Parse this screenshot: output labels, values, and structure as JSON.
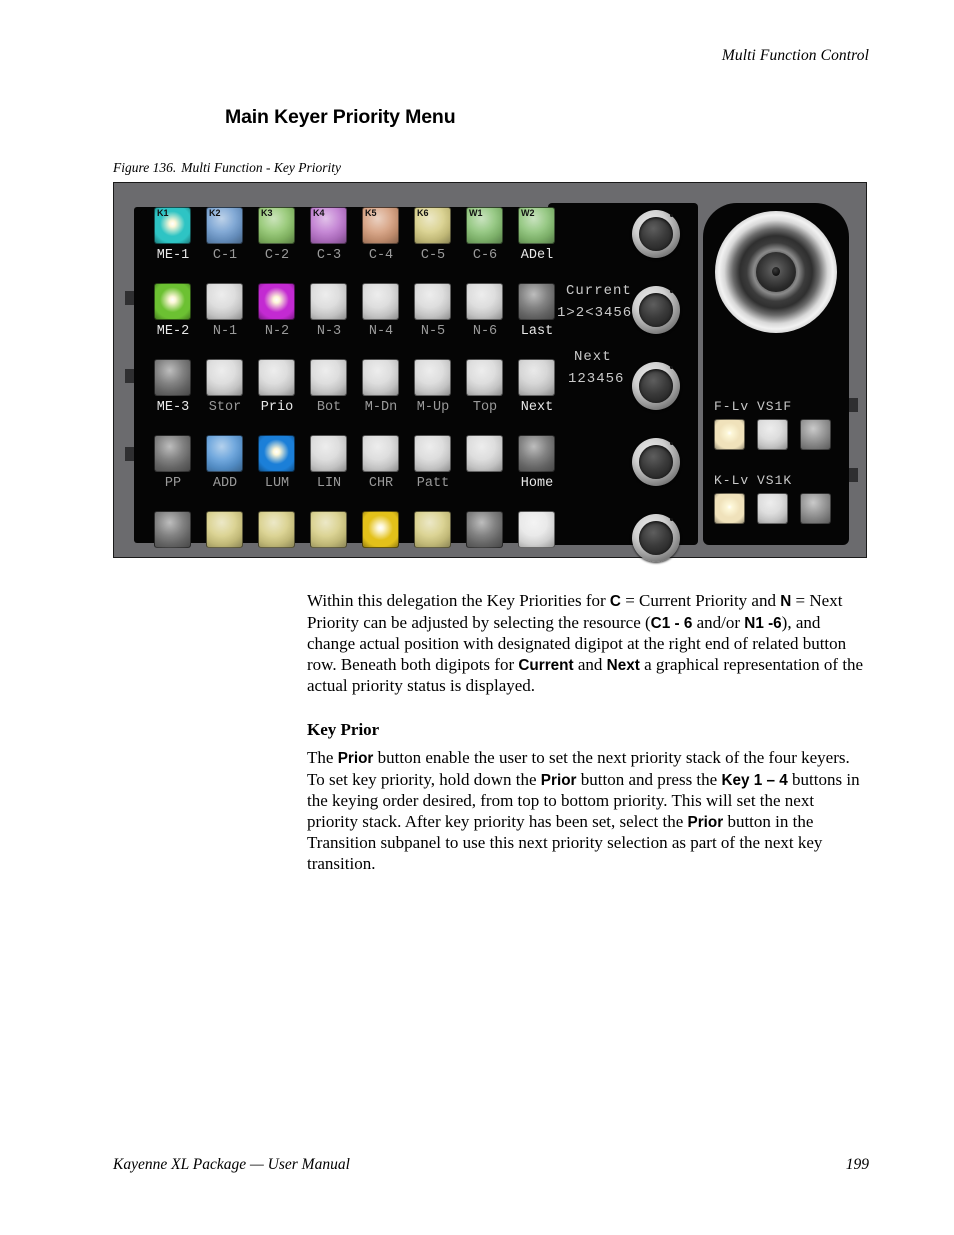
{
  "page": {
    "running_head": "Multi Function Control",
    "title": "Main Keyer Priority Menu",
    "figure_number": "Figure 136.",
    "figure_caption": "Multi Function - Key Priority",
    "footer_left": "Kayenne XL Package  —  User Manual",
    "footer_page": "199"
  },
  "panel": {
    "display": {
      "current_label": "Current",
      "current_value": "1>2<3456",
      "next_label": "Next",
      "next_value": "123456"
    },
    "digipot_count": 5,
    "joystick": {
      "name": "joystick"
    },
    "rows": [
      {
        "id": "row-1",
        "labels": [
          "ME-1",
          "C-1",
          "C-2",
          "C-3",
          "C-4",
          "C-5",
          "C-6",
          "ADel"
        ],
        "label_tone": [
          "bright",
          "dim",
          "dim",
          "dim",
          "dim",
          "dim",
          "dim",
          "bright"
        ],
        "buttons": [
          {
            "cap": "K1",
            "color": "#2ec4c4",
            "lit": true
          },
          {
            "cap": "K2",
            "color": "#6f9ccf",
            "lit": false
          },
          {
            "cap": "K3",
            "color": "#8dc46a",
            "lit": false
          },
          {
            "cap": "K4",
            "color": "#bd76cf",
            "lit": false
          },
          {
            "cap": "K5",
            "color": "#d39a78",
            "lit": false
          },
          {
            "cap": "K6",
            "color": "#d6cd84",
            "lit": false
          },
          {
            "cap": "W1",
            "color": "#88c173",
            "lit": false
          },
          {
            "cap": "W2",
            "color": "#88c173",
            "lit": false
          }
        ]
      },
      {
        "id": "row-2",
        "labels": [
          "ME-2",
          "N-1",
          "N-2",
          "N-3",
          "N-4",
          "N-5",
          "N-6",
          "Last"
        ],
        "label_tone": [
          "bright",
          "dim",
          "dim",
          "dim",
          "dim",
          "dim",
          "dim",
          "bright"
        ],
        "buttons": [
          {
            "cap": "",
            "color": "#6cc132",
            "lit": true
          },
          {
            "cap": "",
            "color": "#d8d8d8",
            "lit": false
          },
          {
            "cap": "",
            "color": "#c32ad2",
            "lit": true
          },
          {
            "cap": "",
            "color": "#d8d8d8",
            "lit": false
          },
          {
            "cap": "",
            "color": "#d8d8d8",
            "lit": false
          },
          {
            "cap": "",
            "color": "#d8d8d8",
            "lit": false
          },
          {
            "cap": "",
            "color": "#d8d8d8",
            "lit": false
          },
          {
            "cap": "",
            "color": "#6e6e6e",
            "lit": false
          }
        ]
      },
      {
        "id": "row-3",
        "labels": [
          "ME-3",
          "Stor",
          "Prio",
          "Bot",
          "M-Dn",
          "M-Up",
          "Top",
          "Next"
        ],
        "label_tone": [
          "bright",
          "dim",
          "bright",
          "dim",
          "dim",
          "dim",
          "dim",
          "bright"
        ],
        "buttons": [
          {
            "cap": "",
            "color": "#6e6e6e",
            "lit": false
          },
          {
            "cap": "",
            "color": "#d8d8d8",
            "lit": false
          },
          {
            "cap": "",
            "color": "#d8d8d8",
            "lit": false
          },
          {
            "cap": "",
            "color": "#d8d8d8",
            "lit": false
          },
          {
            "cap": "",
            "color": "#d8d8d8",
            "lit": false
          },
          {
            "cap": "",
            "color": "#d8d8d8",
            "lit": false
          },
          {
            "cap": "",
            "color": "#d8d8d8",
            "lit": false
          },
          {
            "cap": "",
            "color": "#d0d0d0",
            "lit": false
          }
        ]
      },
      {
        "id": "row-4",
        "labels": [
          "PP",
          "ADD",
          "LUM",
          "LIN",
          "CHR",
          "Patt",
          "",
          "Home"
        ],
        "label_tone": [
          "dim",
          "dim",
          "dim",
          "dim",
          "dim",
          "dim",
          "dim",
          "bright"
        ],
        "buttons": [
          {
            "cap": "",
            "color": "#6e6e6e",
            "lit": false
          },
          {
            "cap": "",
            "color": "#5a9ad8",
            "lit": false
          },
          {
            "cap": "",
            "color": "#1b7fd8",
            "lit": true
          },
          {
            "cap": "",
            "color": "#d8d8d8",
            "lit": false
          },
          {
            "cap": "",
            "color": "#d8d8d8",
            "lit": false
          },
          {
            "cap": "",
            "color": "#d8d8d8",
            "lit": false
          },
          {
            "cap": "",
            "color": "#d8d8d8",
            "lit": false
          },
          {
            "cap": "",
            "color": "#6e6e6e",
            "lit": false
          }
        ]
      },
      {
        "id": "row-5",
        "labels": [],
        "label_tone": [],
        "buttons": [
          {
            "cap": "",
            "color": "#6e6e6e",
            "lit": false
          },
          {
            "cap": "",
            "color": "#d6cd84",
            "lit": false
          },
          {
            "cap": "",
            "color": "#d6cd84",
            "lit": false
          },
          {
            "cap": "",
            "color": "#d6cd84",
            "lit": false
          },
          {
            "cap": "",
            "color": "#e3c11a",
            "lit": true
          },
          {
            "cap": "",
            "color": "#d6cd84",
            "lit": false
          },
          {
            "cap": "",
            "color": "#6e6e6e",
            "lit": false
          },
          {
            "cap": "",
            "color": "#e6e6e6",
            "lit": false
          }
        ]
      }
    ],
    "joystick_section": {
      "labels_top": [
        "F-Lv",
        "VS1F"
      ],
      "labels_bottom": [
        "K-Lv",
        "VS1K"
      ],
      "buttons_top": [
        {
          "color": "#f0e2bb",
          "lit": true
        },
        {
          "color": "#d8d8d8",
          "lit": false
        },
        {
          "color": "#8a8a8a",
          "lit": false
        }
      ],
      "buttons_bottom": [
        {
          "color": "#f0e2bb",
          "lit": true
        },
        {
          "color": "#d8d8d8",
          "lit": false
        },
        {
          "color": "#8a8a8a",
          "lit": false
        }
      ]
    }
  },
  "body": {
    "para1": {
      "t1": "Within this delegation the Key Priorities for ",
      "b1": "C",
      "t2": " = Current Priority and ",
      "b2": "N",
      "t3": " = Next Priority can be adjusted by selecting the resource (",
      "b3": "C1 - 6",
      "t4": " and/or ",
      "b4": "N1 -6",
      "t5": "), and change actual position with designated digipot at the right end of related button row. Beneath both digipots for ",
      "b5": "Current",
      "t6": " and ",
      "b6": "Next",
      "t7": " a graphical representation of the actual priority status is displayed."
    },
    "section_heading": "Key Prior",
    "para2": {
      "t1": "The ",
      "b1": "Prior",
      "t2": " button enable the user to set the next priority stack of the four keyers. To set key priority, hold down the ",
      "b2": "Prior",
      "t3": " button and press the ",
      "b3": "Key 1 – 4",
      "t4": " buttons in the keying order desired, from top to bottom priority. This will set the next priority stack. After key priority has been set, select the ",
      "b4": "Prior",
      "t5": " button in the Transition subpanel to use this next priority selection as part of the next key transition."
    }
  }
}
